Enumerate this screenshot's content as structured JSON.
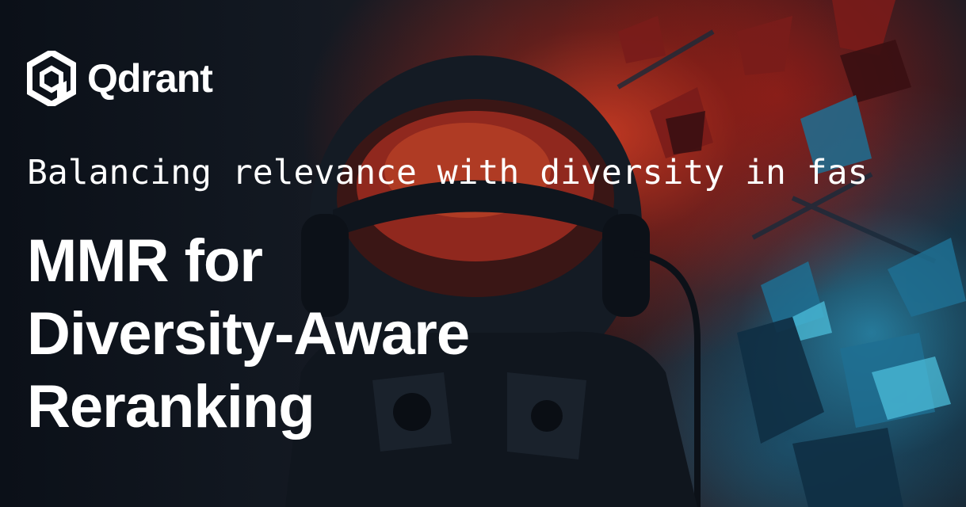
{
  "brand": {
    "name": "Qdrant",
    "logo_icon": "qdrant-hexagon-icon",
    "color": "#ffffff"
  },
  "subtitle": "Balancing relevance with diversity in fas",
  "headline": {
    "lines": [
      "MMR for",
      "Diversity-Aware",
      "Reranking"
    ]
  },
  "background": {
    "illustration": "astronaut-illustration",
    "accent_red": "#d63e24",
    "accent_blue": "#2a9fc4"
  }
}
